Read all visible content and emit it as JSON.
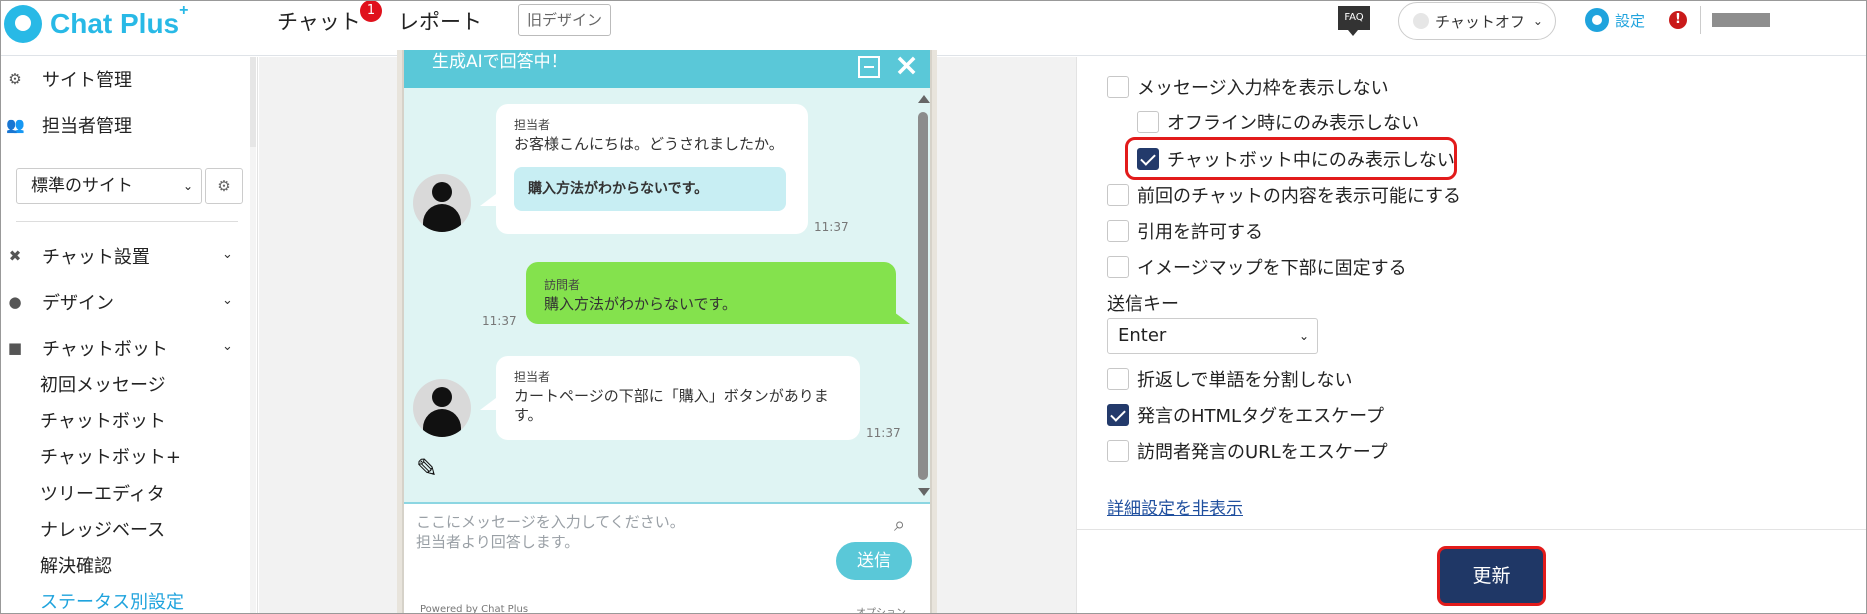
{
  "header": {
    "logo_text": "Chat Plus",
    "logo_plus": "+",
    "nav_chat": "チャット",
    "nav_chat_badge": "1",
    "nav_report": "レポート",
    "old_design": "旧デザイン",
    "faq": "FAQ",
    "chat_status": "チャットオフ",
    "settings": "設定",
    "alert": "!"
  },
  "sidebar": {
    "site_admin": "サイト管理",
    "staff_admin": "担当者管理",
    "site_select": "標準のサイト",
    "chat_setup": "チャット設置",
    "design": "デザイン",
    "chatbot": "チャットボット",
    "sub_items": [
      "初回メッセージ",
      "チャットボット",
      "チャットボット+",
      "ツリーエディタ",
      "ナレッジベース",
      "解決確認",
      "ステータス別設定"
    ]
  },
  "chat": {
    "header_title": "生成AIで回答中！",
    "messages": [
      {
        "sender": "担当者",
        "text": "お客様こんにちは。どうされましたか。",
        "quick_reply": "購入方法がわからないです。",
        "time": "11:37"
      },
      {
        "sender": "訪問者",
        "text": "購入方法がわからないです。",
        "time": "11:37"
      },
      {
        "sender": "担当者",
        "text_line1": "カートページの下部に「購入」ボタンがありま",
        "text_line2": "す。",
        "time": "11:37"
      }
    ],
    "input_placeholder_line1": "ここにメッセージを入力してください。",
    "input_placeholder_line2": "担当者より回答します。",
    "send": "送信",
    "powered": "Powered by Chat Plus",
    "options": "オプション"
  },
  "settings": {
    "options": [
      {
        "label": "メッセージ入力枠を表示しない",
        "checked": false
      },
      {
        "label": "オフライン時にのみ表示しない",
        "checked": false
      },
      {
        "label": "チャットボット中にのみ表示しない",
        "checked": true
      },
      {
        "label": "前回のチャットの内容を表示可能にする",
        "checked": false
      },
      {
        "label": "引用を許可する",
        "checked": false
      },
      {
        "label": "イメージマップを下部に固定する",
        "checked": false
      },
      {
        "label": "折返しで単語を分割しない",
        "checked": false
      },
      {
        "label": "発言のHTMLタグをエスケープ",
        "checked": true
      },
      {
        "label": "訪問者発言のURLをエスケープ",
        "checked": false
      }
    ],
    "send_key_label": "送信キー",
    "send_key_value": "Enter",
    "detail_link": "詳細設定を非表示",
    "update": "更新"
  },
  "colors": {
    "brand": "#28b9e6",
    "chat_header": "#5ac8d8",
    "visitor_bubble": "#84e24d",
    "update_button": "#1f3766",
    "highlight": "#e21b1b"
  }
}
